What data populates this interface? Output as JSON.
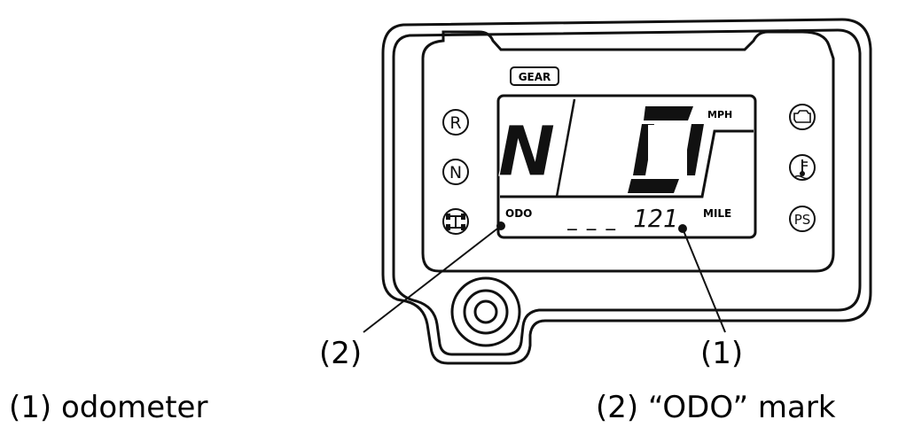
{
  "display": {
    "gear_box_label": "GEAR",
    "gear_value": "N",
    "speed_value": "0",
    "speed_unit": "MPH",
    "odo_mark": "ODO",
    "odometer_dashes": "_ _ _",
    "odometer_value": "121",
    "odometer_unit": "MILE"
  },
  "left_indicators": [
    {
      "label": "R"
    },
    {
      "label": "N"
    },
    {
      "label": "4WD-icon"
    }
  ],
  "right_indicators": [
    {
      "label": "engine-icon"
    },
    {
      "label": "coolant-temp-icon"
    },
    {
      "label": "PS"
    }
  ],
  "callouts": {
    "num_1": "(1)",
    "num_2": "(2)"
  },
  "captions": {
    "caption_1": "(1) odometer",
    "caption_2": "(2) “ODO” mark"
  }
}
